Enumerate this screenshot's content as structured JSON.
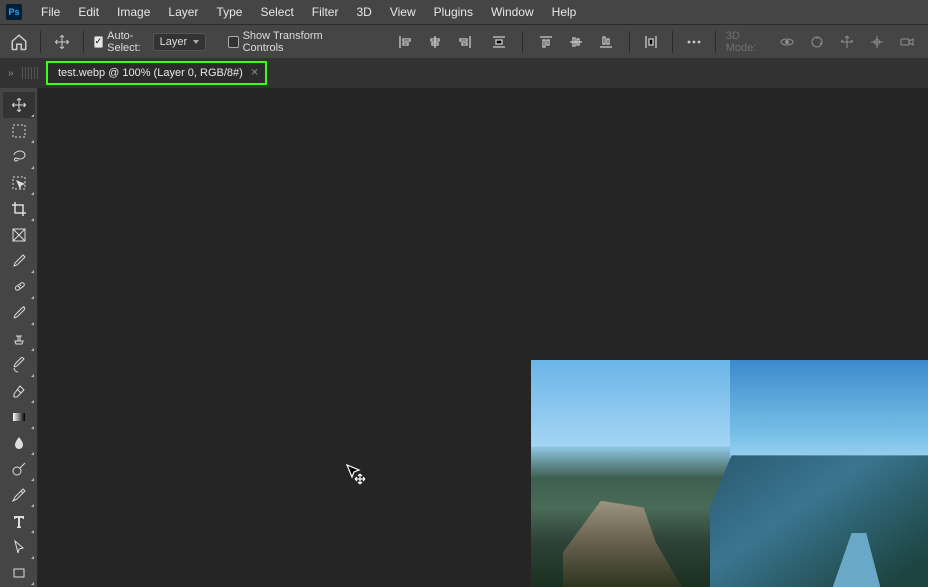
{
  "menu": {
    "items": [
      "File",
      "Edit",
      "Image",
      "Layer",
      "Type",
      "Select",
      "Filter",
      "3D",
      "View",
      "Plugins",
      "Window",
      "Help"
    ]
  },
  "options": {
    "auto_select_label": "Auto-Select:",
    "auto_select_checked": true,
    "auto_select_scope": "Layer",
    "show_transform_label": "Show Transform Controls",
    "show_transform_checked": false,
    "mode3d_label": "3D Mode:"
  },
  "tab": {
    "label": "test.webp @ 100% (Layer 0, RGB/8#)"
  },
  "tools": [
    "move",
    "marquee",
    "lasso",
    "object-select",
    "crop",
    "frame",
    "eyedropper",
    "healing",
    "brush",
    "clone",
    "history-brush",
    "eraser",
    "gradient",
    "blur",
    "dodge",
    "pen",
    "type",
    "path-select",
    "rectangle"
  ],
  "highlight_color": "#39ff14"
}
